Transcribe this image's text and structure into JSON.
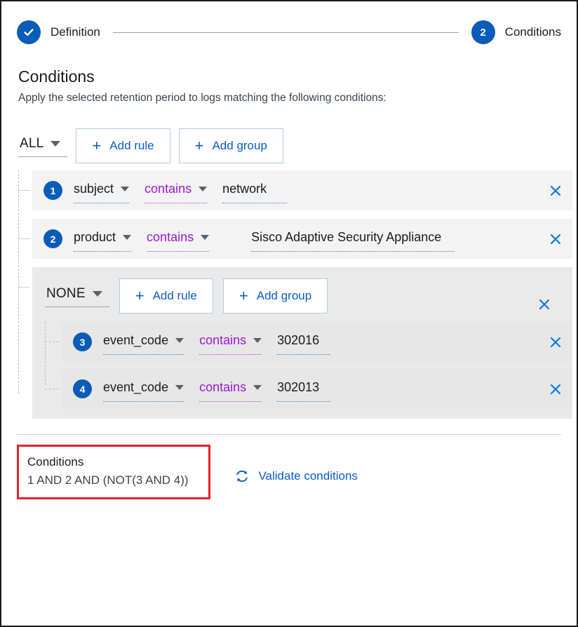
{
  "stepper": {
    "steps": [
      {
        "label": "Definition",
        "state": "done",
        "icon": "check-icon",
        "number": ""
      },
      {
        "label": "Conditions",
        "state": "active",
        "icon": "",
        "number": "2"
      }
    ]
  },
  "header": {
    "title": "Conditions",
    "description": "Apply the selected retention period to logs matching the following conditions:"
  },
  "root_group": {
    "combinator": "ALL",
    "add_rule_label": "Add rule",
    "add_group_label": "Add group",
    "plus": "+"
  },
  "rules": [
    {
      "number": "1",
      "field": "subject",
      "operator": "contains",
      "value": "network",
      "value_width": 92
    },
    {
      "number": "2",
      "field": "product",
      "operator": "contains",
      "value": "Sisco Adaptive Security Appliance",
      "value_width": 290
    }
  ],
  "nested_group": {
    "combinator": "NONE",
    "add_rule_label": "Add rule",
    "add_group_label": "Add group",
    "plus": "+",
    "rules": [
      {
        "number": "3",
        "field": "event_code",
        "operator": "contains",
        "value": "302016",
        "value_width": 76
      },
      {
        "number": "4",
        "field": "event_code",
        "operator": "contains",
        "value": "302013",
        "value_width": 76
      }
    ]
  },
  "summary": {
    "title": "Conditions",
    "expression": "1 AND 2 AND (NOT(3 AND 4))"
  },
  "validate": {
    "label": "Validate conditions",
    "icon": "refresh-icon"
  },
  "colors": {
    "accent_blue": "#0a5cb8",
    "link_blue": "#0b5cc8",
    "operator_purple": "#9b19d3",
    "row_bg": "#f3f3f3",
    "nested_bg": "#eaeaea",
    "highlight_red": "#e8202a"
  }
}
